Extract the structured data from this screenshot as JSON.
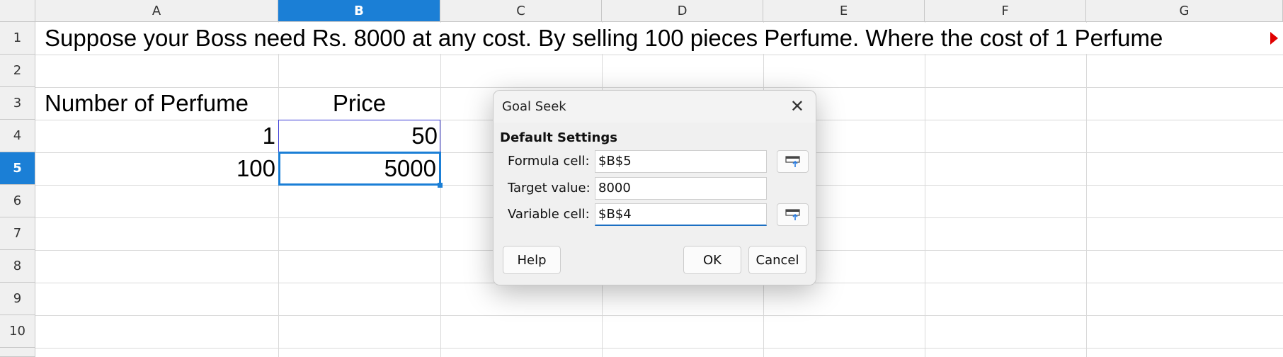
{
  "columns": [
    "A",
    "B",
    "C",
    "D",
    "E",
    "F",
    "G"
  ],
  "rows": [
    "1",
    "2",
    "3",
    "4",
    "5",
    "6",
    "7",
    "8",
    "9",
    "10"
  ],
  "selected_column": "B",
  "selected_row": "5",
  "cells": {
    "A1": "Suppose your Boss need Rs. 8000 at any cost. By selling 100 pieces Perfume. Where the cost of 1 Perfume",
    "A3": "Number of Perfume",
    "B3": "Price",
    "A4": "1",
    "B4": "50",
    "A5": "100",
    "B5": "5000"
  },
  "dialog": {
    "title": "Goal Seek",
    "close_icon": "close-icon",
    "section": "Default Settings",
    "formula_cell": {
      "label": "Formula cell:",
      "value": "$B$5"
    },
    "target_value": {
      "label": "Target value:",
      "value": "8000"
    },
    "variable_cell": {
      "label": "Variable cell:",
      "value": "$B$4"
    },
    "buttons": {
      "help": "Help",
      "ok": "OK",
      "cancel": "Cancel"
    }
  },
  "colors": {
    "selection": "#1b7fd6",
    "overflow_indicator": "#e00000"
  }
}
